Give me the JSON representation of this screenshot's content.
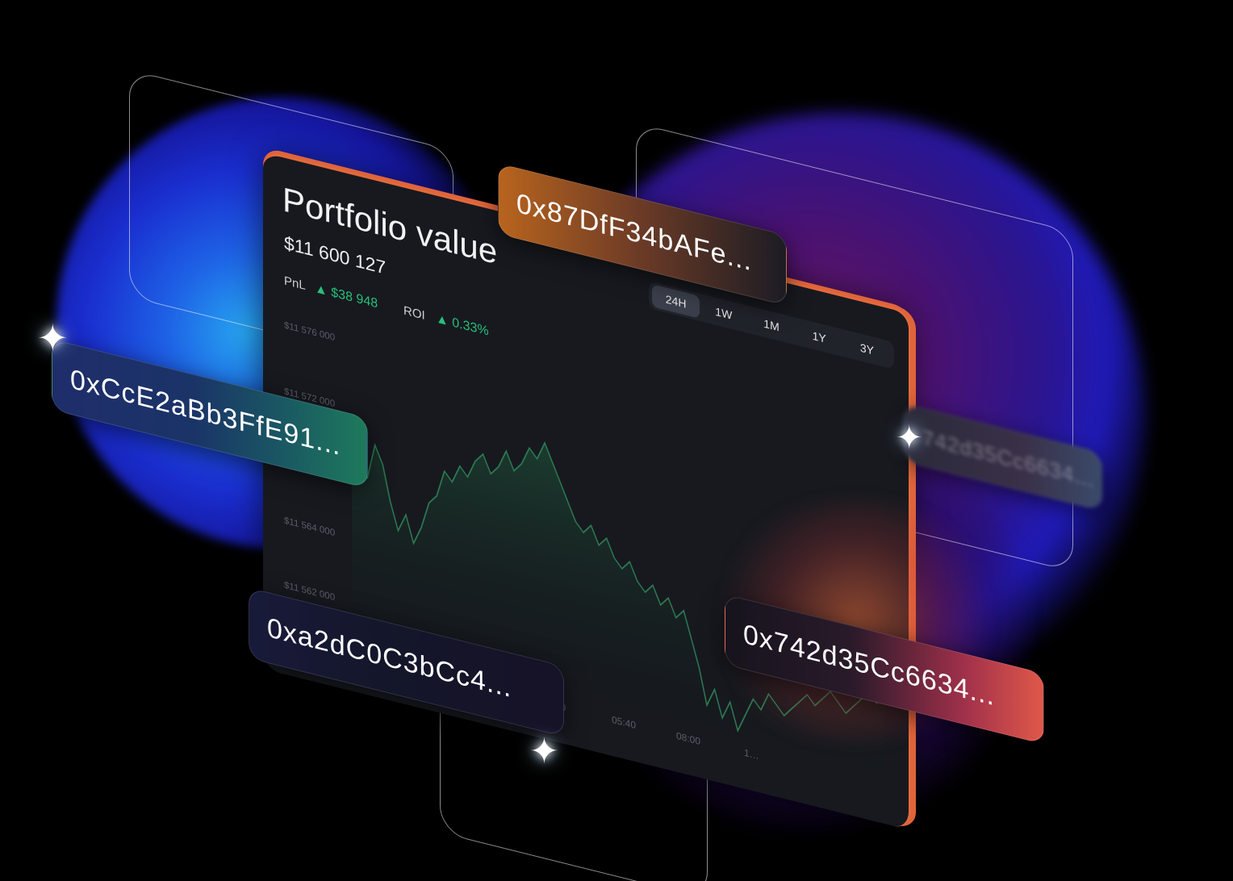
{
  "card": {
    "title": "Portfolio value",
    "value": "$11 600 127",
    "pnl_label": "PnL",
    "pnl_value": "▲ $38 948",
    "roi_label": "ROI",
    "roi_value": "▲ 0.33%",
    "tabs": [
      "24H",
      "1W",
      "1M",
      "1Y",
      "3Y"
    ],
    "active_tab": "24H",
    "y_ticks": [
      "$11 576 000",
      "$11 572 000",
      "$11 564 000",
      "$11 562 000"
    ],
    "x_ticks": [
      "50",
      "05:40",
      "08:00",
      "1…"
    ]
  },
  "addresses": {
    "green": "0xCcE2aBb3FfE91...",
    "orange": "0x87DfF34bAFe...",
    "dark": "0xa2dC0C3bCc4...",
    "red": "0x742d35Cc6634...",
    "ghost": "742d35Cc6634..."
  },
  "colors": {
    "accent_orange": "#e36a3c",
    "positive_green": "#27c07a",
    "card_bg": "#17191f"
  },
  "chart_data": {
    "type": "area",
    "series": [
      {
        "values": [
          11567,
          11571,
          11566,
          11570,
          11568,
          11564,
          11561,
          11563,
          11560,
          11562,
          11565,
          11566,
          11569,
          11568,
          11570,
          11569,
          11571,
          11572,
          11570,
          11571,
          11573,
          11571,
          11572,
          11574,
          11573,
          11575,
          11573,
          11571,
          11569,
          11567,
          11566,
          11567,
          11565,
          11566,
          11564,
          11563,
          11564,
          11562,
          11561,
          11562,
          11560,
          11561,
          11559,
          11560,
          11557,
          11554,
          11550,
          11552,
          11549,
          11551,
          11548,
          11550,
          11552,
          11551,
          11553,
          11552,
          11551,
          11552,
          11553,
          11554,
          11553,
          11554,
          11555,
          11554,
          11553,
          11554,
          11555,
          11556,
          11555,
          11556
        ]
      }
    ],
    "ylim": [
      11548,
      11578
    ]
  }
}
